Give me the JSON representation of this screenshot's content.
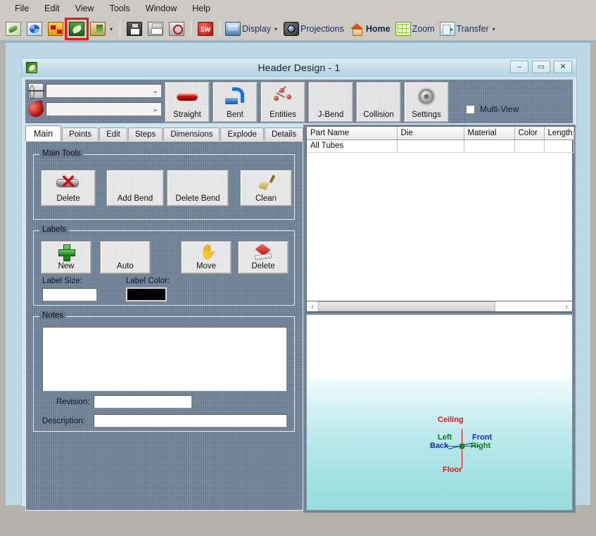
{
  "menubar": {
    "items": [
      {
        "label": "File"
      },
      {
        "label": "Edit"
      },
      {
        "label": "View"
      },
      {
        "label": "Tools"
      },
      {
        "label": "Window"
      },
      {
        "label": "Help"
      }
    ]
  },
  "toolbar": {
    "icon_buttons": [
      {
        "name": "new-icon",
        "selected": false
      },
      {
        "name": "open-icon",
        "selected": false
      },
      {
        "name": "parts-library-icon",
        "selected": false
      },
      {
        "name": "header-design-icon",
        "selected": true
      },
      {
        "name": "export-icon",
        "selected": false
      }
    ],
    "save_icon": "save-icon",
    "print_icon": "print-icon",
    "print_preview_icon": "print-preview-icon",
    "solidworks_icon": "solidworks-icon",
    "solidworks_text": "SW",
    "groups": [
      {
        "label": "Display",
        "icon": "display-icon",
        "has_caret": true
      },
      {
        "label": "Projections",
        "icon": "projections-camera-icon",
        "has_caret": false
      },
      {
        "label": "Home",
        "icon": "home-icon",
        "has_caret": false,
        "bold": true
      },
      {
        "label": "Zoom",
        "icon": "zoom-grid-icon",
        "has_caret": false
      },
      {
        "label": "Transfer",
        "icon": "transfer-icon",
        "has_caret": true
      }
    ]
  },
  "window": {
    "title": "Header Design - 1",
    "icon": "app-leaf-icon",
    "buttons": {
      "minimize": "–",
      "maximize": "▭",
      "close": "✕"
    }
  },
  "topstrip": {
    "combos": [
      {
        "name": "die-combo",
        "icon": "die-icon",
        "value": "",
        "placeholder": ""
      },
      {
        "name": "bend-combo",
        "icon": "bend-icon",
        "value": "",
        "placeholder": ""
      }
    ],
    "buttons": [
      {
        "label": "Straight",
        "icon": "straight-tube-icon"
      },
      {
        "label": "Bent",
        "icon": "bent-tube-icon"
      },
      {
        "label": "Entities",
        "icon": "entities-icon"
      },
      {
        "label": "J-Bend",
        "icon": ""
      },
      {
        "label": "Collision",
        "icon": ""
      },
      {
        "label": "Settings",
        "icon": "gear-icon"
      }
    ],
    "multiview": {
      "label": "Multi-View",
      "checked": false
    }
  },
  "tabs": [
    {
      "label": "Main",
      "active": true
    },
    {
      "label": "Points",
      "active": false
    },
    {
      "label": "Edit",
      "active": false
    },
    {
      "label": "Steps",
      "active": false
    },
    {
      "label": "Dimensions",
      "active": false
    },
    {
      "label": "Explode",
      "active": false
    },
    {
      "label": "Details",
      "active": false
    }
  ],
  "main_tools": {
    "legend": "Main Tools",
    "buttons": [
      {
        "label": "Delete",
        "icon": "delete-tube-icon"
      },
      {
        "label": "Add Bend",
        "icon": ""
      },
      {
        "label": "Delete Bend",
        "icon": ""
      },
      {
        "label": "Clean",
        "icon": "broom-icon"
      }
    ]
  },
  "labels_group": {
    "legend": "Labels",
    "buttons": [
      {
        "label": "New",
        "icon": "plus-icon"
      },
      {
        "label": "Auto",
        "icon": ""
      },
      {
        "label": "Move",
        "icon": "hand-icon"
      },
      {
        "label": "Delete",
        "icon": "eraser-icon"
      }
    ],
    "label_size": {
      "label": "Label Size:",
      "value": ""
    },
    "label_color": {
      "label": "Label Color:",
      "value": "#000000"
    }
  },
  "notes_group": {
    "legend": "Notes",
    "notes_value": "",
    "revision": {
      "label": "Revision:",
      "value": ""
    },
    "description": {
      "label": "Description:",
      "value": ""
    }
  },
  "parts_table": {
    "columns": [
      "Part Name",
      "Die",
      "Material",
      "Color",
      "Length"
    ],
    "rows": [
      [
        "All Tubes",
        "",
        "",
        "",
        ""
      ]
    ],
    "scrollbar": {
      "left_arrow": "‹",
      "right_arrow": "›"
    }
  },
  "viewport": {
    "axis_labels": {
      "ceiling": "Ceiling",
      "floor": "Floor",
      "left": "Left",
      "right": "Right",
      "front": "Front",
      "back": "Back"
    },
    "colors": {
      "vertical_axis": "#e01616",
      "horizontal_axis": "#0a7a18",
      "depth_axis": "#1728c8",
      "origin": "#0a9a18"
    }
  }
}
